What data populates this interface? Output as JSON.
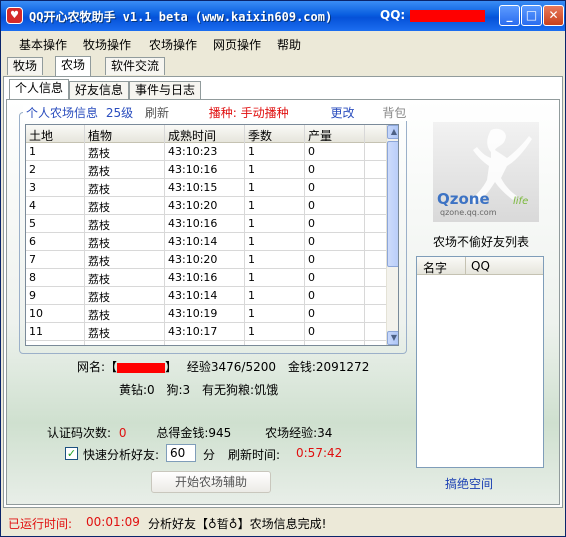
{
  "titlebar": {
    "title": "QQ开心农牧助手  v1.1 beta  (www.kaixin609.com)",
    "qq_label": "QQ:",
    "minimize": "_",
    "maximize": "□",
    "close": "✕"
  },
  "menu": [
    "基本操作",
    "牧场操作",
    "农场操作",
    "网页操作",
    "帮助"
  ],
  "top_tabs": [
    "牧场",
    "农场",
    "软件交流"
  ],
  "sub_tabs": [
    "个人信息",
    "好友信息",
    "事件与日志"
  ],
  "farm_header": {
    "title": "个人农场信息",
    "level": "25级",
    "refresh": "刷新",
    "sow_label": "播种:",
    "sow_mode": "手动播种",
    "change": "更改",
    "backpack": "背包"
  },
  "grid": {
    "columns": [
      "土地",
      "植物",
      "成熟时间",
      "季数",
      "产量"
    ],
    "rows": [
      [
        "1",
        "荔枝",
        "43:10:23",
        "1",
        "0"
      ],
      [
        "2",
        "荔枝",
        "43:10:16",
        "1",
        "0"
      ],
      [
        "3",
        "荔枝",
        "43:10:15",
        "1",
        "0"
      ],
      [
        "4",
        "荔枝",
        "43:10:20",
        "1",
        "0"
      ],
      [
        "5",
        "荔枝",
        "43:10:16",
        "1",
        "0"
      ],
      [
        "6",
        "荔枝",
        "43:10:14",
        "1",
        "0"
      ],
      [
        "7",
        "荔枝",
        "43:10:20",
        "1",
        "0"
      ],
      [
        "8",
        "荔枝",
        "43:10:16",
        "1",
        "0"
      ],
      [
        "9",
        "荔枝",
        "43:10:14",
        "1",
        "0"
      ],
      [
        "10",
        "荔枝",
        "43:10:19",
        "1",
        "0"
      ],
      [
        "11",
        "荔枝",
        "43:10:17",
        "1",
        "0"
      ]
    ]
  },
  "profile": {
    "name_prefix": "网名:【",
    "name_suffix": "】",
    "exp": "经验3476/5200",
    "gold": "金钱:2091272",
    "yellow_diamond": "黄钻:0",
    "dog": "狗:3",
    "dog_food": "有无狗粮:饥饿"
  },
  "stats": {
    "captcha_label": "认证码次数:",
    "captcha_value": "0",
    "total_gold": "总得金钱:945",
    "farm_exp": "农场经验:34"
  },
  "quick": {
    "checkbox": "✓",
    "label": "快速分析好友:",
    "value": "60",
    "unit": "分",
    "refresh_label": "刷新时间:",
    "refresh_value": "0:57:42"
  },
  "start_button": "开始农场辅助",
  "qzone": {
    "logo": "Qzone",
    "logo_life": "life",
    "url": "qzone.qq.com"
  },
  "friend_list": {
    "title": "农场不偷好友列表",
    "col_name": "名字",
    "col_qq": "QQ",
    "link": "搞绝空间"
  },
  "status": {
    "runtime_label": "已运行时间:",
    "runtime_value": "00:01:09",
    "message": "分析好友【♁晢♁】农场信息完成!"
  },
  "colors": {
    "accent_blue": "#2a4dbe",
    "red_text": "#e01010",
    "title_blue": "#0551d8"
  }
}
